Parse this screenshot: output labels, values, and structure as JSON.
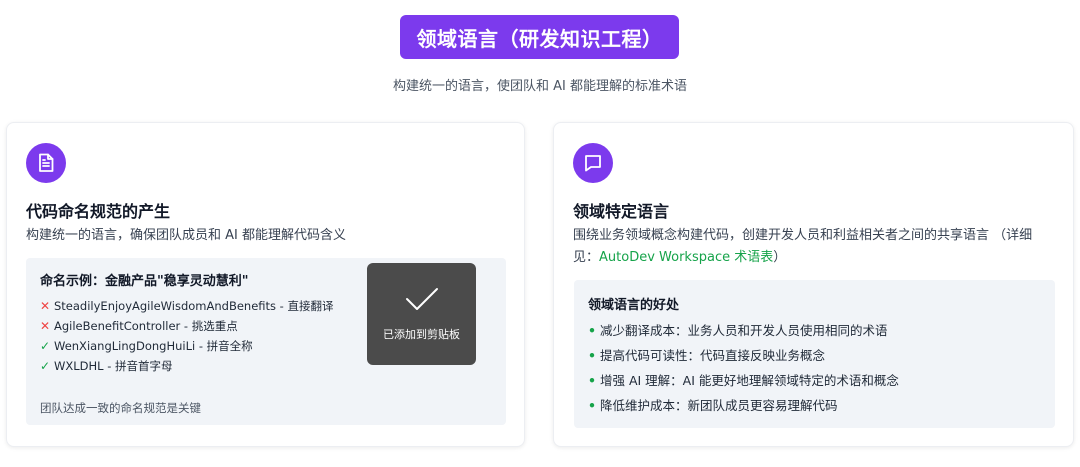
{
  "header": {
    "title": "领域语言（研发知识工程）",
    "subtitle": "构建统一的语言，使团队和 AI 都能理解的标准术语"
  },
  "left_card": {
    "icon": "document-icon",
    "title": "代码命名规范的产生",
    "description": "构建统一的语言，确保团队成员和 AI 都能理解代码含义",
    "example": {
      "title": "命名示例：金融产品\"稳享灵动慧利\"",
      "items": [
        {
          "mark": "✕",
          "status": "bad",
          "text": "SteadilyEnjoyAgileWisdomAndBenefits - 直接翻译"
        },
        {
          "mark": "✕",
          "status": "bad",
          "text": "AgileBenefitController - 挑选重点"
        },
        {
          "mark": "✓",
          "status": "good",
          "text": "WenXiangLingDongHuiLi - 拼音全称"
        },
        {
          "mark": "✓",
          "status": "good",
          "text": "WXLDHL - 拼音首字母"
        }
      ],
      "note": "团队达成一致的命名规范是关键"
    },
    "toast": {
      "icon": "checkmark-icon",
      "label": "已添加到剪贴板"
    }
  },
  "right_card": {
    "icon": "chat-bubble-icon",
    "title": "领域特定语言",
    "description_line1": "围绕业务领域概念构建代码，创建开发人员和利益相关者之间的共享语言 （详细",
    "description_prefix": "见：",
    "description_link": "AutoDev Workspace 术语表",
    "description_suffix": "）",
    "benefits": {
      "title": "领域语言的好处",
      "bullet": "•",
      "items": [
        "减少翻译成本：业务人员和开发人员使用相同的术语",
        "提高代码可读性：代码直接反映业务概念",
        "增强 AI 理解：AI 能更好地理解领域特定的术语和概念",
        "降低维护成本：新团队成员更容易理解代码"
      ]
    }
  },
  "colors": {
    "accent": "#7c3aed",
    "good": "#16a34a",
    "bad": "#ef4444",
    "toast_bg": "#4b4b4b",
    "panel_bg": "#f1f4f8"
  }
}
